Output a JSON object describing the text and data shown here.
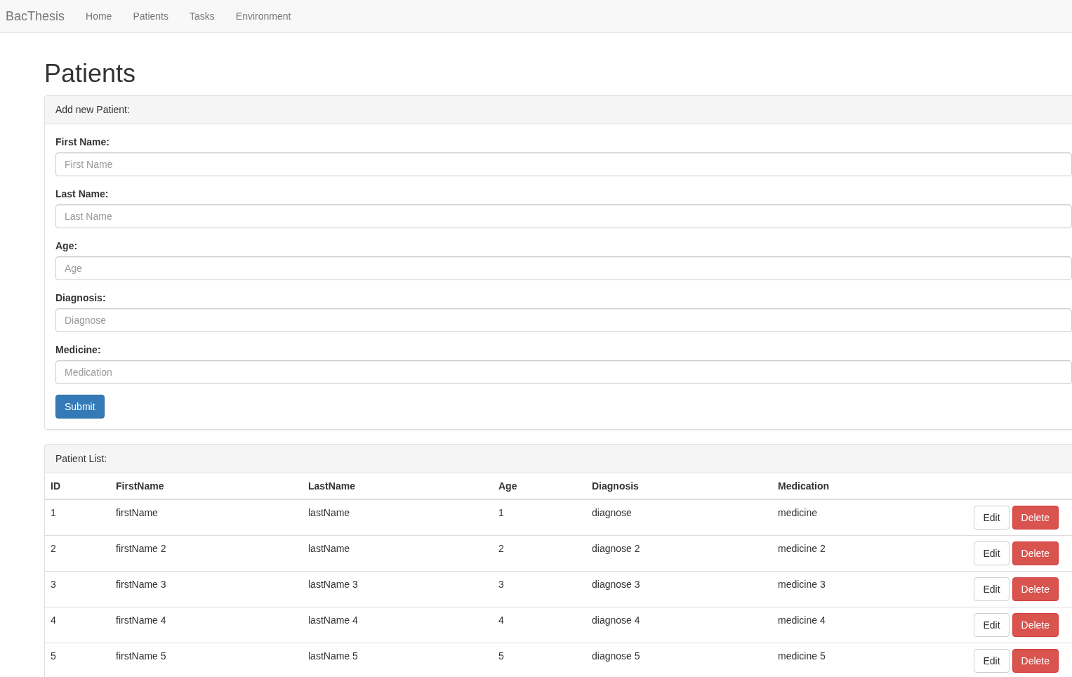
{
  "navbar": {
    "brand": "BacThesis",
    "links": [
      "Home",
      "Patients",
      "Tasks",
      "Environment"
    ]
  },
  "page_title": "Patients",
  "add_panel": {
    "heading": "Add new Patient:",
    "fields": [
      {
        "label": "First Name:",
        "placeholder": "First Name"
      },
      {
        "label": "Last Name:",
        "placeholder": "Last Name"
      },
      {
        "label": "Age:",
        "placeholder": "Age"
      },
      {
        "label": "Diagnosis:",
        "placeholder": "Diagnose"
      },
      {
        "label": "Medicine:",
        "placeholder": "Medication"
      }
    ],
    "submit": "Submit"
  },
  "list_panel": {
    "heading": "Patient List:",
    "table": {
      "columns": [
        "ID",
        "FirstName",
        "LastName",
        "Age",
        "Diagnosis",
        "Medication"
      ],
      "rows": [
        {
          "cells": [
            "1",
            "firstName",
            "lastName",
            "1",
            "diagnose",
            "medicine"
          ],
          "edit": "Edit",
          "delete": "Delete"
        },
        {
          "cells": [
            "2",
            "firstName 2",
            "lastName",
            "2",
            "diagnose 2",
            "medicine 2"
          ],
          "edit": "Edit",
          "delete": "Delete"
        },
        {
          "cells": [
            "3",
            "firstName 3",
            "lastName 3",
            "3",
            "diagnose 3",
            "medicine 3"
          ],
          "edit": "Edit",
          "delete": "Delete"
        },
        {
          "cells": [
            "4",
            "firstName 4",
            "lastName 4",
            "4",
            "diagnose 4",
            "medicine 4"
          ],
          "edit": "Edit",
          "delete": "Delete"
        },
        {
          "cells": [
            "5",
            "firstName 5",
            "lastName 5",
            "5",
            "diagnose 5",
            "medicine 5"
          ],
          "edit": "Edit",
          "delete": "Delete"
        }
      ]
    }
  }
}
